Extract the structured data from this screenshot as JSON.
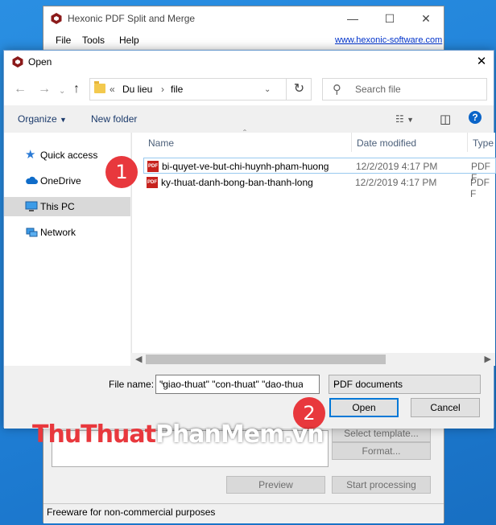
{
  "main_window": {
    "title": "Hexonic PDF Split and Merge",
    "menu": [
      "File",
      "Tools",
      "Help"
    ],
    "website": "www.hexonic-software.com",
    "buttons": {
      "select_template": "Select template...",
      "format": "Format...",
      "preview": "Preview",
      "start_processing": "Start processing"
    },
    "status_text": "Freeware for non-commercial purposes"
  },
  "dialog": {
    "title": "Open",
    "breadcrumb": [
      "Du lieu",
      "file"
    ],
    "search_placeholder": "Search file",
    "toolbar": {
      "organize": "Organize",
      "new_folder": "New folder"
    },
    "sidebar": [
      {
        "label": "Quick access",
        "icon": "star-icon",
        "selected": false
      },
      {
        "label": "OneDrive",
        "icon": "cloud-icon",
        "selected": false
      },
      {
        "label": "This PC",
        "icon": "computer-icon",
        "selected": true
      },
      {
        "label": "Network",
        "icon": "network-icon",
        "selected": false
      }
    ],
    "columns": [
      "Name",
      "Date modified",
      "Type"
    ],
    "files": [
      {
        "name": "bi-quyet-ve-but-chi-huynh-pham-huong",
        "date": "12/2/2019 4:17 PM",
        "type": "PDF F"
      },
      {
        "name": "ky-thuat-danh-bong-ban-thanh-long",
        "date": "12/2/2019 4:17 PM",
        "type": "PDF F"
      }
    ],
    "file_name_label": "File name:",
    "file_name_value": "\"giao-thuat\" \"con-thuat\" \"dao-thuat\"",
    "file_type": "PDF documents",
    "open_label": "Open",
    "cancel_label": "Cancel"
  },
  "annotations": {
    "step1": "1",
    "step2": "2"
  },
  "watermark": {
    "red_part": "ThuThuat",
    "white_part": "PhanMem",
    "red_tail": ".vn"
  },
  "colors": {
    "accent": "#0078d7",
    "badge": "#e8383d",
    "desktop": "#1f7fd6"
  }
}
